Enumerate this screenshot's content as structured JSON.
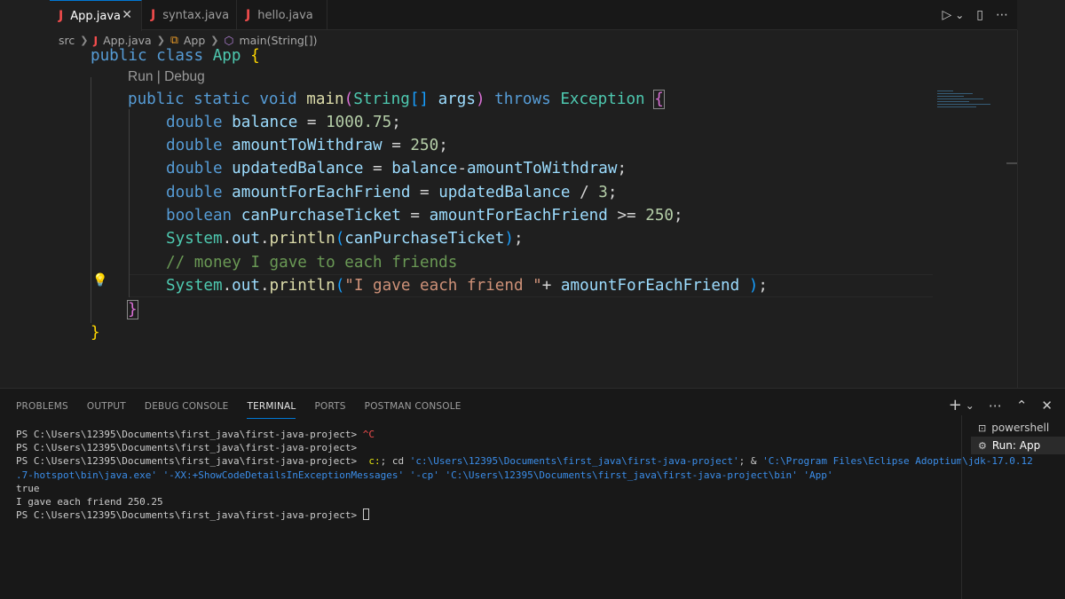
{
  "tabs": [
    {
      "icon": "J",
      "label": "App.java",
      "active": true,
      "close": "✕"
    },
    {
      "icon": "J",
      "label": "syntax.java",
      "active": false
    },
    {
      "icon": "J",
      "label": "hello.java",
      "active": false
    }
  ],
  "editor_actions": {
    "run": "▷",
    "run_menu": "⌄",
    "split": "▯",
    "more": "⋯"
  },
  "breadcrumb": {
    "folder": "src",
    "file_icon": "J",
    "file": "App.java",
    "class_icon": "⧉",
    "class": "App",
    "method_icon": "⬡",
    "method": "main(String[])"
  },
  "codelens": "Run | Debug",
  "code": {
    "l1_kw1": "public",
    "l1_kw2": "class",
    "l1_class": "App",
    "l1_brace": "{",
    "l2_kw1": "public",
    "l2_kw2": "static",
    "l2_kw3": "void",
    "l2_fn": "main",
    "l2_p1": "(",
    "l2_type": "String",
    "l2_br": "[]",
    "l2_arg": "args",
    "l2_p2": ")",
    "l2_throws": "throws",
    "l2_exc": "Exception",
    "l2_brace": "{",
    "l3_type": "double",
    "l3_var": "balance",
    "l3_op": " = ",
    "l3_num": "1000.75",
    "l3_end": ";",
    "l4_type": "double",
    "l4_var": "amountToWithdraw",
    "l4_op": " = ",
    "l4_num": "250",
    "l4_end": ";",
    "l5_type": "double",
    "l5_var": "updatedBalance",
    "l5_op": " = ",
    "l5_v1": "balance",
    "l5_minus": "-",
    "l5_v2": "amountToWithdraw",
    "l5_end": ";",
    "l6_type": "double",
    "l6_var": "amountForEachFriend",
    "l6_op": " = ",
    "l6_v1": "updatedBalance",
    "l6_div": " / ",
    "l6_num": "3",
    "l6_end": ";",
    "l7_type": "boolean",
    "l7_var": "canPurchaseTicket",
    "l7_op": " = ",
    "l7_v1": "amountForEachFriend",
    "l7_cmp": " >= ",
    "l7_num": "250",
    "l7_end": ";",
    "l8_sys": "System",
    "l8_dot1": ".",
    "l8_out": "out",
    "l8_dot2": ".",
    "l8_fn": "println",
    "l8_p1": "(",
    "l8_arg": "canPurchaseTicket",
    "l8_p2": ")",
    "l8_end": ";",
    "l9_comment": "// money I gave to each friends",
    "l10_sys": "System",
    "l10_dot1": ".",
    "l10_out": "out",
    "l10_dot2": ".",
    "l10_fn": "println",
    "l10_p1": "(",
    "l10_str": "\"I gave each friend \"",
    "l10_plus": "+ ",
    "l10_arg": "amountForEachFriend",
    "l10_sp": " ",
    "l10_p2": ")",
    "l10_end": ";",
    "l11_brace": "}",
    "l12_brace": "}"
  },
  "lightbulb": "💡",
  "panel": {
    "tabs": [
      "PROBLEMS",
      "OUTPUT",
      "DEBUG CONSOLE",
      "TERMINAL",
      "PORTS",
      "POSTMAN CONSOLE"
    ],
    "active_tab": "TERMINAL",
    "actions": {
      "add": "+",
      "add_menu": "⌄",
      "more": "⋯",
      "maximize": "⌃",
      "close": "✕"
    }
  },
  "terminal": {
    "prompt": "PS C:\\Users\\12395\\Documents\\first_java\\first-java-project> ",
    "line1_ctrl": "^C",
    "line3_cmd_a": "c:",
    "line3_cmd_b": "; cd ",
    "line3_cmd_c": "'c:\\Users\\12395\\Documents\\first_java\\first-java-project'",
    "line3_cmd_d": "; & ",
    "line3_cmd_e": "'C:\\Program Files\\Eclipse Adoptium\\jdk-17.0.12",
    "line4": ".7-hotspot\\bin\\java.exe' '-XX:+ShowCodeDetailsInExceptionMessages' '-cp' 'C:\\Users\\12395\\Documents\\first_java\\first-java-project\\bin' 'App'",
    "output1": "true",
    "output2": "I gave each friend 250.25"
  },
  "terminal_list": [
    {
      "icon": "⊡",
      "label": "powershell",
      "active": false
    },
    {
      "icon": "⚙",
      "label": "Run: App",
      "active": true
    }
  ]
}
